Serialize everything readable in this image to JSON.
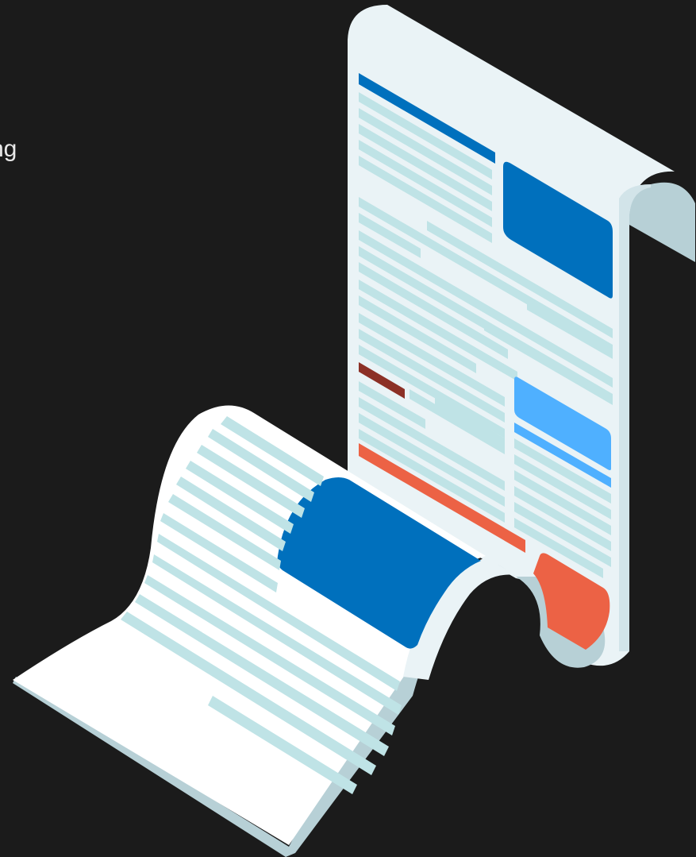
{
  "page": {
    "visible_text_fragment": "ng"
  },
  "illustration": {
    "icon": "scrolling-document-illustration",
    "colors": {
      "background": "#1b1b1b",
      "paper": "#eaf3f6",
      "paper_front": "#ffffff",
      "paper_edge": "#b7d0d6",
      "text_lines": "#bfe3e6",
      "primary_blue": "#0070bd",
      "light_blue": "#4fb0ff",
      "orange": "#ec6245",
      "dark_red": "#8c3026"
    }
  }
}
